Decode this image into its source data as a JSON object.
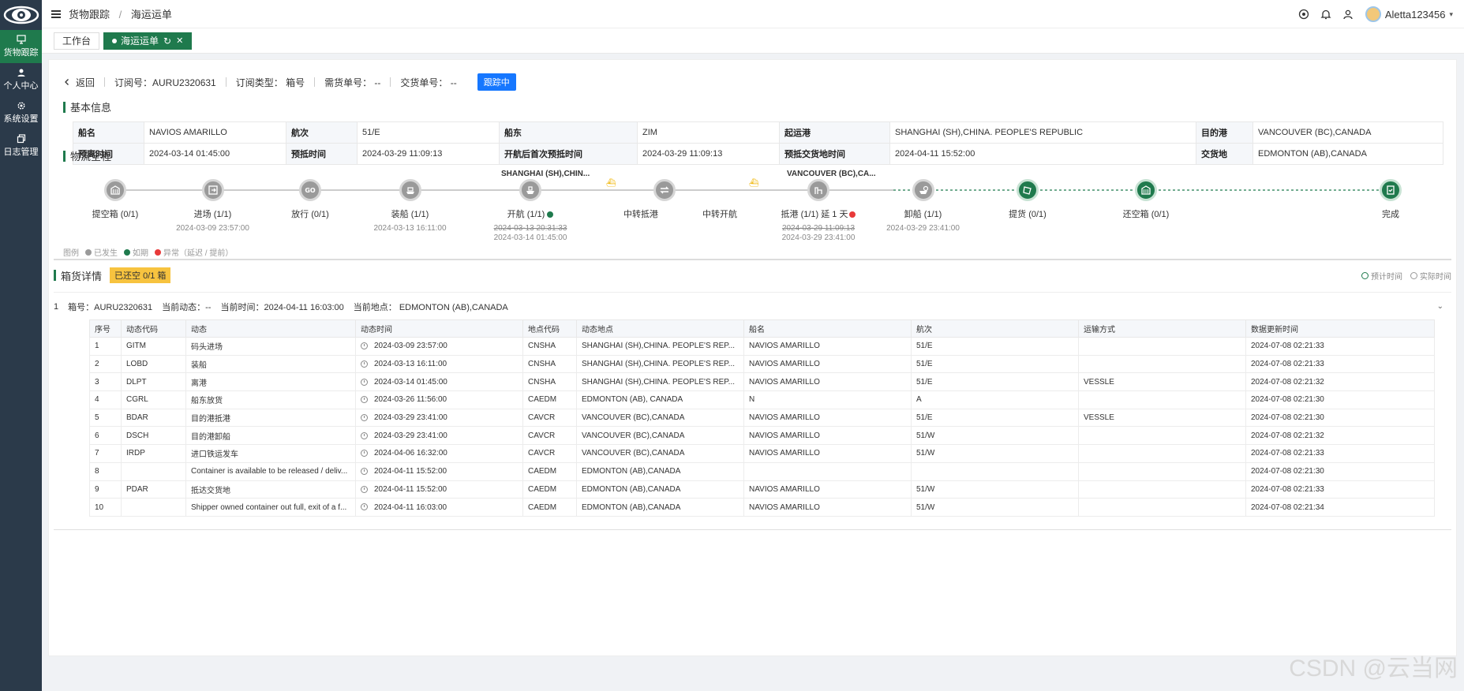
{
  "sidebar": {
    "logo_icon": "eye-logo-icon",
    "items": [
      {
        "label": "货物跟踪",
        "icon": "monitor-icon",
        "active": true
      },
      {
        "label": "个人中心",
        "icon": "user-icon",
        "active": false
      },
      {
        "label": "系统设置",
        "icon": "gear-icon",
        "active": false
      },
      {
        "label": "日志管理",
        "icon": "copy-icon",
        "active": false
      }
    ]
  },
  "header": {
    "breadcrumb": [
      "货物跟踪",
      "海运运单"
    ],
    "separator": "/",
    "username": "Aletta123456",
    "caret": "▾"
  },
  "tabs": [
    {
      "label": "工作台",
      "active": false
    },
    {
      "label": "海运运单",
      "active": true,
      "refresh": "↻",
      "close": "✕"
    }
  ],
  "toprow": {
    "back": "返回",
    "order_no": "订阅号：AURU2320631",
    "order_type": "订阅类型：  箱号",
    "need_no": "需货单号：  --",
    "delivery_no": "交货单号：  --",
    "status": "跟踪中"
  },
  "basic": {
    "title": "基本信息",
    "rows": [
      [
        {
          "k": "船名",
          "v": "NAVIOS AMARILLO"
        },
        {
          "k": "航次",
          "v": "51/E"
        },
        {
          "k": "船东",
          "v": "ZIM"
        },
        {
          "k": "起运港",
          "v": "SHANGHAI (SH),CHINA. PEOPLE'S REPUBLIC"
        },
        {
          "k": "目的港",
          "v": "VANCOUVER (BC),CANADA"
        }
      ],
      [
        {
          "k": "预离时间",
          "v": "2024-03-14 01:45:00"
        },
        {
          "k": "预抵时间",
          "v": "2024-03-29 11:09:13"
        },
        {
          "k": "开航后首次预抵时间",
          "v": "2024-03-29 11:09:13"
        },
        {
          "k": "预抵交货地时间",
          "v": "2024-04-11 15:52:00"
        },
        {
          "k": "交货地",
          "v": "EDMONTON (AB),CANADA"
        }
      ]
    ]
  },
  "timeline": {
    "title": "物流全程",
    "origin_port": "SHANGHAI (SH),CHIN...",
    "dest_port": "VANCOUVER (BC),CA...",
    "ship_glyph": "⛴",
    "nodes": [
      {
        "label": "提空箱 (0/1)",
        "icon": "container-icon",
        "state": "done",
        "t1": "",
        "t2": ""
      },
      {
        "label": "进场 (1/1)",
        "icon": "gate-icon",
        "state": "done",
        "t1": "2024-03-09 23:57:00",
        "t2": ""
      },
      {
        "label": "放行 (0/1)",
        "icon": "go-icon",
        "state": "done",
        "t1": "",
        "t2": ""
      },
      {
        "label": "装船 (1/1)",
        "icon": "load-ship-icon",
        "state": "done",
        "t1": "2024-03-13 16:11:00",
        "t2": ""
      },
      {
        "label": "开航 (1/1)",
        "icon": "depart-ship-icon",
        "state": "done",
        "t1": "2024-03-13 20:31:33",
        "t2": "2024-03-14 01:45:00",
        "strike": true,
        "dot": "green"
      },
      {
        "label": "中转抵港",
        "icon": "",
        "state": "none",
        "t1": "",
        "t2": ""
      },
      {
        "label": "",
        "icon": "swap-icon",
        "state": "done",
        "t1": "",
        "t2": ""
      },
      {
        "label": "中转开航",
        "icon": "",
        "state": "none",
        "t1": "",
        "t2": ""
      },
      {
        "label": "抵港 (1/1)  延 1 天",
        "icon": "arrive-port-icon",
        "state": "done",
        "t1": "2024-03-29 11:09:13",
        "t2": "2024-03-29 23:41:00",
        "strike": true,
        "dot": "red"
      },
      {
        "label": "卸船 (1/1)",
        "icon": "unload-ship-icon",
        "state": "done",
        "t1": "2024-03-29 23:41:00",
        "t2": ""
      },
      {
        "label": "提货 (0/1)",
        "icon": "pickup-icon",
        "state": "pending",
        "t1": "",
        "t2": ""
      },
      {
        "label": "还空箱 (0/1)",
        "icon": "return-container-icon",
        "state": "pending",
        "t1": "",
        "t2": ""
      },
      {
        "label": "完成",
        "icon": "clipboard-check-icon",
        "state": "pending",
        "t1": "",
        "t2": ""
      }
    ],
    "legend": {
      "title": "图例",
      "items": [
        {
          "label": "已发生",
          "color": "#9a9a9a"
        },
        {
          "label": "如期",
          "color": "#1f7a4d"
        },
        {
          "label": "异常（延迟 / 提前）",
          "color": "#e83a3a"
        }
      ]
    }
  },
  "box": {
    "title": "箱货详情",
    "tag": "已还空 0/1 箱",
    "legend_expected": "预计时间",
    "legend_actual": "实际时间",
    "row": {
      "index": "1",
      "box_no": "箱号：AURU2320631",
      "cur_status": "当前动态：--",
      "cur_time": "当前时间：2024-04-11 16:03:00",
      "cur_place": "当前地点：  EDMONTON (AB),CANADA",
      "chevron": "⌄"
    }
  },
  "events": {
    "headers": [
      "序号",
      "动态代码",
      "动态",
      "动态时间",
      "地点代码",
      "动态地点",
      "船名",
      "航次",
      "运输方式",
      "数据更新时间"
    ],
    "rows": [
      [
        "1",
        "GITM",
        "码头进场",
        "2024-03-09 23:57:00",
        "CNSHA",
        "SHANGHAI (SH),CHINA. PEOPLE'S REP...",
        "NAVIOS AMARILLO",
        "51/E",
        "",
        "2024-07-08 02:21:33"
      ],
      [
        "2",
        "LOBD",
        "装船",
        "2024-03-13 16:11:00",
        "CNSHA",
        "SHANGHAI (SH),CHINA. PEOPLE'S REP...",
        "NAVIOS AMARILLO",
        "51/E",
        "",
        "2024-07-08 02:21:33"
      ],
      [
        "3",
        "DLPT",
        "离港",
        "2024-03-14 01:45:00",
        "CNSHA",
        "SHANGHAI (SH),CHINA. PEOPLE'S REP...",
        "NAVIOS AMARILLO",
        "51/E",
        "VESSLE",
        "2024-07-08 02:21:32"
      ],
      [
        "4",
        "CGRL",
        "船东放货",
        "2024-03-26 11:56:00",
        "CAEDM",
        "EDMONTON (AB), CANADA",
        "N",
        "A",
        "",
        "2024-07-08 02:21:30"
      ],
      [
        "5",
        "BDAR",
        "目的港抵港",
        "2024-03-29 23:41:00",
        "CAVCR",
        "VANCOUVER (BC),CANADA",
        "NAVIOS AMARILLO",
        "51/E",
        "VESSLE",
        "2024-07-08 02:21:30"
      ],
      [
        "6",
        "DSCH",
        "目的港卸船",
        "2024-03-29 23:41:00",
        "CAVCR",
        "VANCOUVER (BC),CANADA",
        "NAVIOS AMARILLO",
        "51/W",
        "",
        "2024-07-08 02:21:32"
      ],
      [
        "7",
        "IRDP",
        "进口铁运发车",
        "2024-04-06 16:32:00",
        "CAVCR",
        "VANCOUVER (BC),CANADA",
        "NAVIOS AMARILLO",
        "51/W",
        "",
        "2024-07-08 02:21:33"
      ],
      [
        "8",
        "",
        "Container is available to be released / deliv...",
        "2024-04-11 15:52:00",
        "CAEDM",
        "EDMONTON (AB),CANADA",
        "",
        "",
        "",
        "2024-07-08 02:21:30"
      ],
      [
        "9",
        "PDAR",
        "抵达交货地",
        "2024-04-11 15:52:00",
        "CAEDM",
        "EDMONTON (AB),CANADA",
        "NAVIOS AMARILLO",
        "51/W",
        "",
        "2024-07-08 02:21:33"
      ],
      [
        "10",
        "",
        "Shipper owned container out full, exit of a f...",
        "2024-04-11 16:03:00",
        "CAEDM",
        "EDMONTON (AB),CANADA",
        "NAVIOS AMARILLO",
        "51/W",
        "",
        "2024-07-08 02:21:34"
      ]
    ]
  },
  "watermark": "CSDN @云当网",
  "colors": {
    "sidebar": "#2b3a4a",
    "accent": "#1f7a4d",
    "primary": "#1677ff",
    "warn": "#f7c33f",
    "danger": "#e83a3a"
  }
}
